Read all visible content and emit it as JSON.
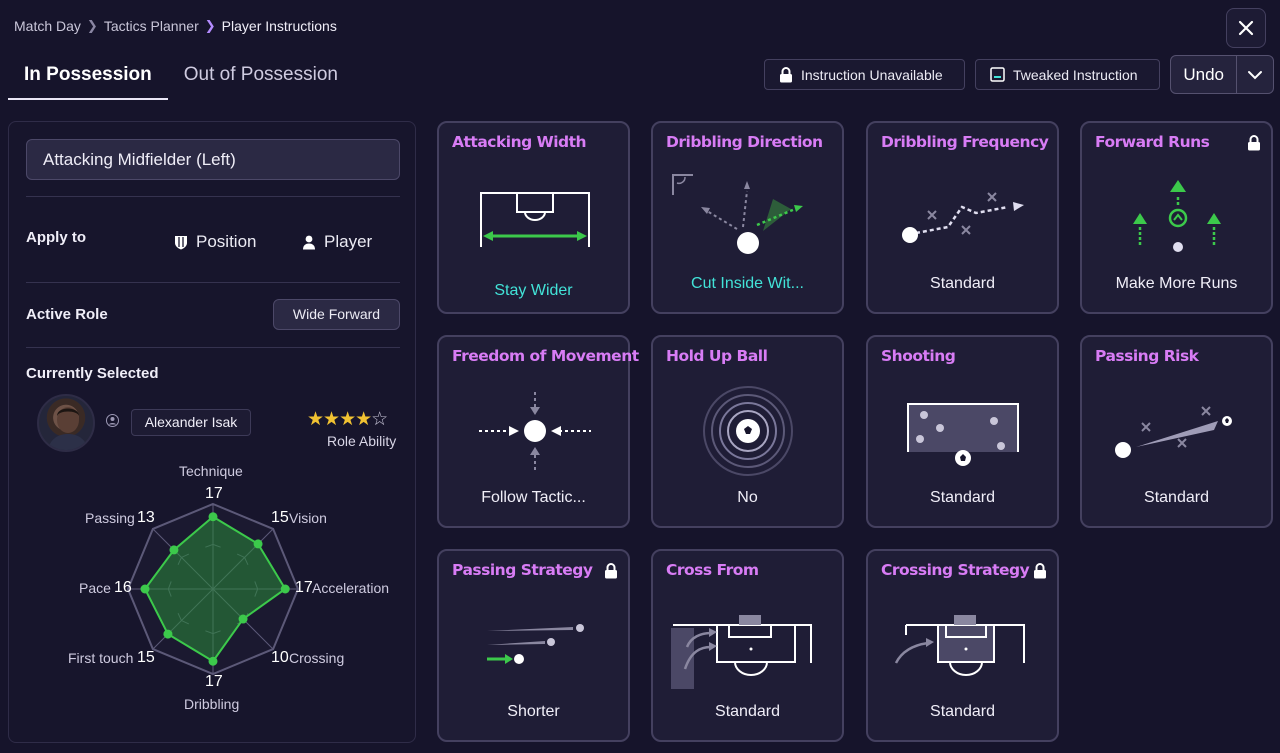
{
  "breadcrumb": {
    "items": [
      "Match Day",
      "Tactics Planner",
      "Player Instructions"
    ]
  },
  "close_icon": "close-icon",
  "tabs": [
    {
      "label": "In Possession",
      "active": true
    },
    {
      "label": "Out of Possession",
      "active": false
    }
  ],
  "legend": {
    "unavailable": "Instruction Unavailable",
    "tweaked": "Tweaked Instruction"
  },
  "undo": {
    "label": "Undo"
  },
  "left_panel": {
    "role_select": "Attacking Midfielder (Left)",
    "apply_to": {
      "label": "Apply to",
      "position": "Position",
      "player": "Player"
    },
    "active_role": {
      "label": "Active Role",
      "value": "Wide Forward"
    },
    "currently_selected": {
      "label": "Currently Selected",
      "player_name": "Alexander Isak",
      "role_ability_label": "Role Ability",
      "stars": {
        "filled": 4,
        "total": 5
      }
    },
    "attributes": [
      {
        "name": "Technique",
        "value": "17"
      },
      {
        "name": "Vision",
        "value": "15"
      },
      {
        "name": "Acceleration",
        "value": "17"
      },
      {
        "name": "Crossing",
        "value": "10"
      },
      {
        "name": "Dribbling",
        "value": "17"
      },
      {
        "name": "First touch",
        "value": "15"
      },
      {
        "name": "Pace",
        "value": "16"
      },
      {
        "name": "Passing",
        "value": "13"
      }
    ]
  },
  "instructions": [
    {
      "title": "Attacking Width",
      "value": "Stay Wider",
      "locked": false,
      "tweaked": true
    },
    {
      "title": "Dribbling Direction",
      "value": "Cut Inside Wit...",
      "locked": false,
      "tweaked": true
    },
    {
      "title": "Dribbling Frequency",
      "value": "Standard",
      "locked": false,
      "tweaked": false
    },
    {
      "title": "Forward Runs",
      "value": "Make More Runs",
      "locked": true,
      "tweaked": false
    },
    {
      "title": "Freedom of Movement",
      "value": "Follow Tactic...",
      "locked": false,
      "tweaked": false
    },
    {
      "title": "Hold Up Ball",
      "value": "No",
      "locked": false,
      "tweaked": false
    },
    {
      "title": "Shooting",
      "value": "Standard",
      "locked": false,
      "tweaked": false
    },
    {
      "title": "Passing Risk",
      "value": "Standard",
      "locked": false,
      "tweaked": false
    },
    {
      "title": "Passing Strategy",
      "value": "Shorter",
      "locked": true,
      "tweaked": false
    },
    {
      "title": "Cross From",
      "value": "Standard",
      "locked": false,
      "tweaked": false
    },
    {
      "title": "Crossing Strategy",
      "value": "Standard",
      "locked": true,
      "tweaked": false
    }
  ],
  "colors": {
    "background": "#16142b",
    "card_title": "#d87cf5",
    "tweaked_value": "#42e3d8",
    "radar_fill": "#2a8a3a",
    "radar_point": "#3cc94b",
    "star": "#f1c232"
  }
}
